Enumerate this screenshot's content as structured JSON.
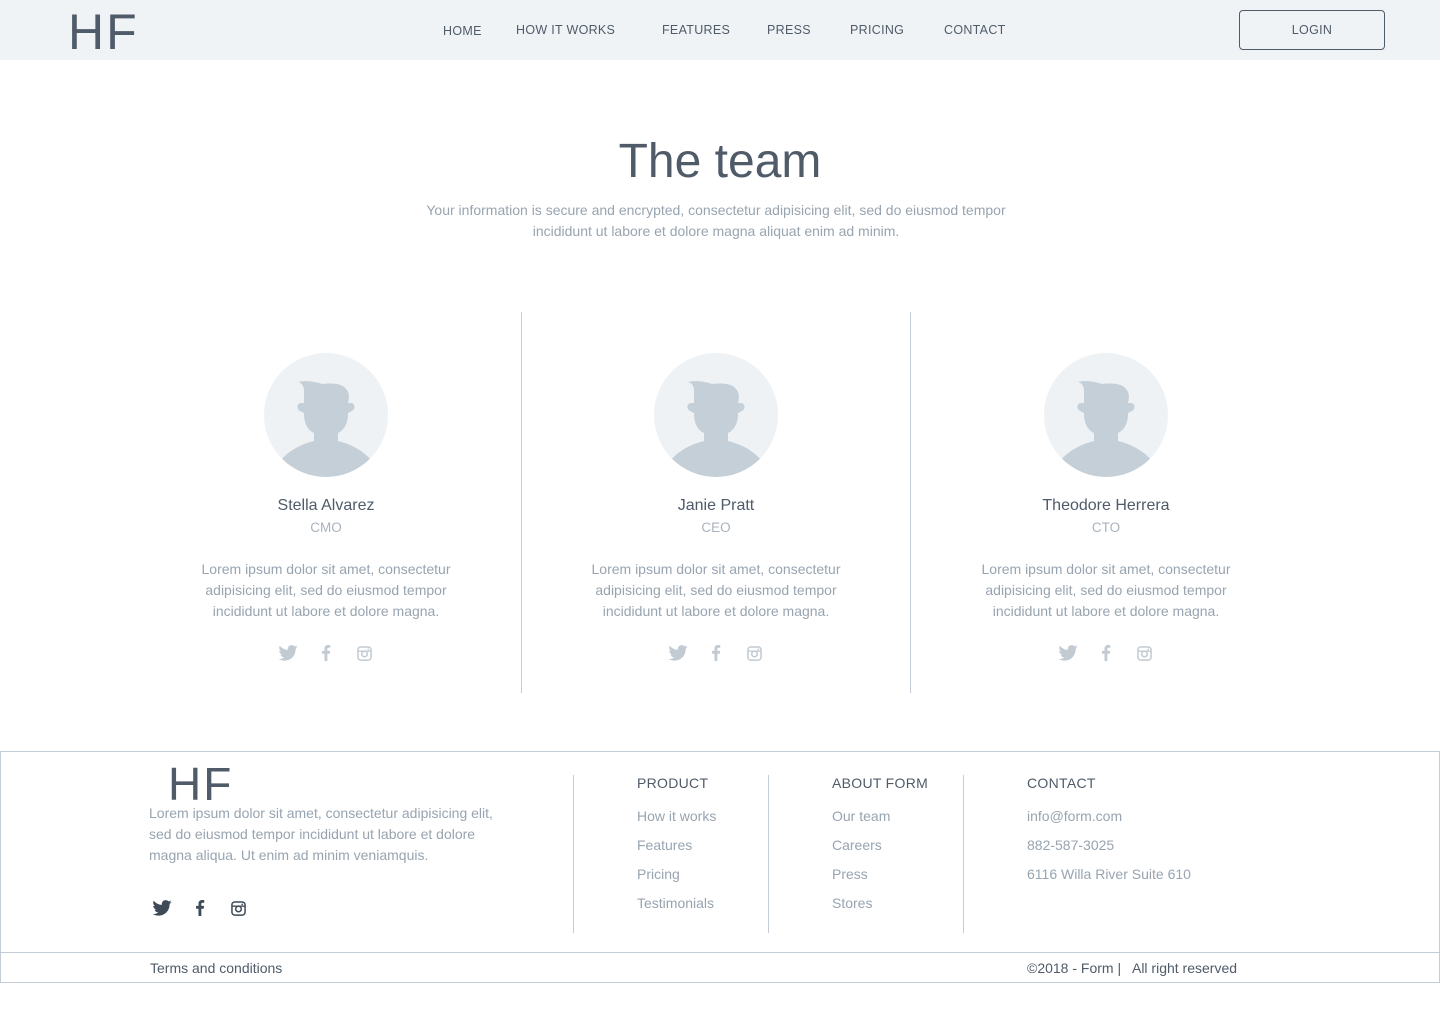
{
  "header": {
    "logo": "HF",
    "nav": [
      "HOME",
      "HOW IT WORKS",
      "FEATURES",
      "PRESS",
      "PRICING",
      "CONTACT"
    ],
    "login_label": "LOGIN"
  },
  "hero": {
    "title": "The team",
    "intro": "Your information is secure and encrypted, consectetur adipisicing elit, sed do eiusmod tempor incididunt ut labore et dolore magna aliquat enim ad minim."
  },
  "team": [
    {
      "name": "Stella Alvarez",
      "role": "CMO",
      "bio": "Lorem ipsum dolor sit amet, consectetur adipisicing elit, sed do eiusmod tempor incididunt ut labore et dolore magna."
    },
    {
      "name": "Janie Pratt",
      "role": "CEO",
      "bio": "Lorem ipsum dolor sit amet, consectetur adipisicing elit, sed do eiusmod tempor incididunt ut labore et dolore magna."
    },
    {
      "name": "Theodore Herrera",
      "role": "CTO",
      "bio": "Lorem ipsum dolor sit amet, consectetur adipisicing elit, sed do eiusmod tempor incididunt ut labore et dolore magna."
    }
  ],
  "social_icons": [
    "twitter-icon",
    "facebook-icon",
    "instagram-icon"
  ],
  "footer": {
    "logo": "HF",
    "description": "Lorem ipsum dolor sit amet, consectetur adipisicing elit, sed do eiusmod tempor incididunt ut labore et dolore magna aliqua. Ut enim ad minim veniamquis.",
    "columns": [
      {
        "title": "PRODUCT",
        "links": [
          "How it works",
          "Features",
          "Pricing",
          "Testimonials"
        ]
      },
      {
        "title": "ABOUT FORM",
        "links": [
          "Our team",
          "Careers",
          "Press",
          "Stores"
        ]
      },
      {
        "title": "CONTACT",
        "links": [
          "info@form.com",
          "882-587-3025",
          "6116 Willa River Suite 610"
        ]
      }
    ],
    "terms": "Terms and conditions",
    "copyright": "©2018 - Form |   All right reserved"
  },
  "colors": {
    "text_dark": "#4f5b69",
    "text_muted": "#98a4b0",
    "header_bg": "#f0f3f6",
    "avatar_bg": "#eef2f5",
    "avatar_figure": "#c4cfd8",
    "divider": "#c4cdd5"
  }
}
